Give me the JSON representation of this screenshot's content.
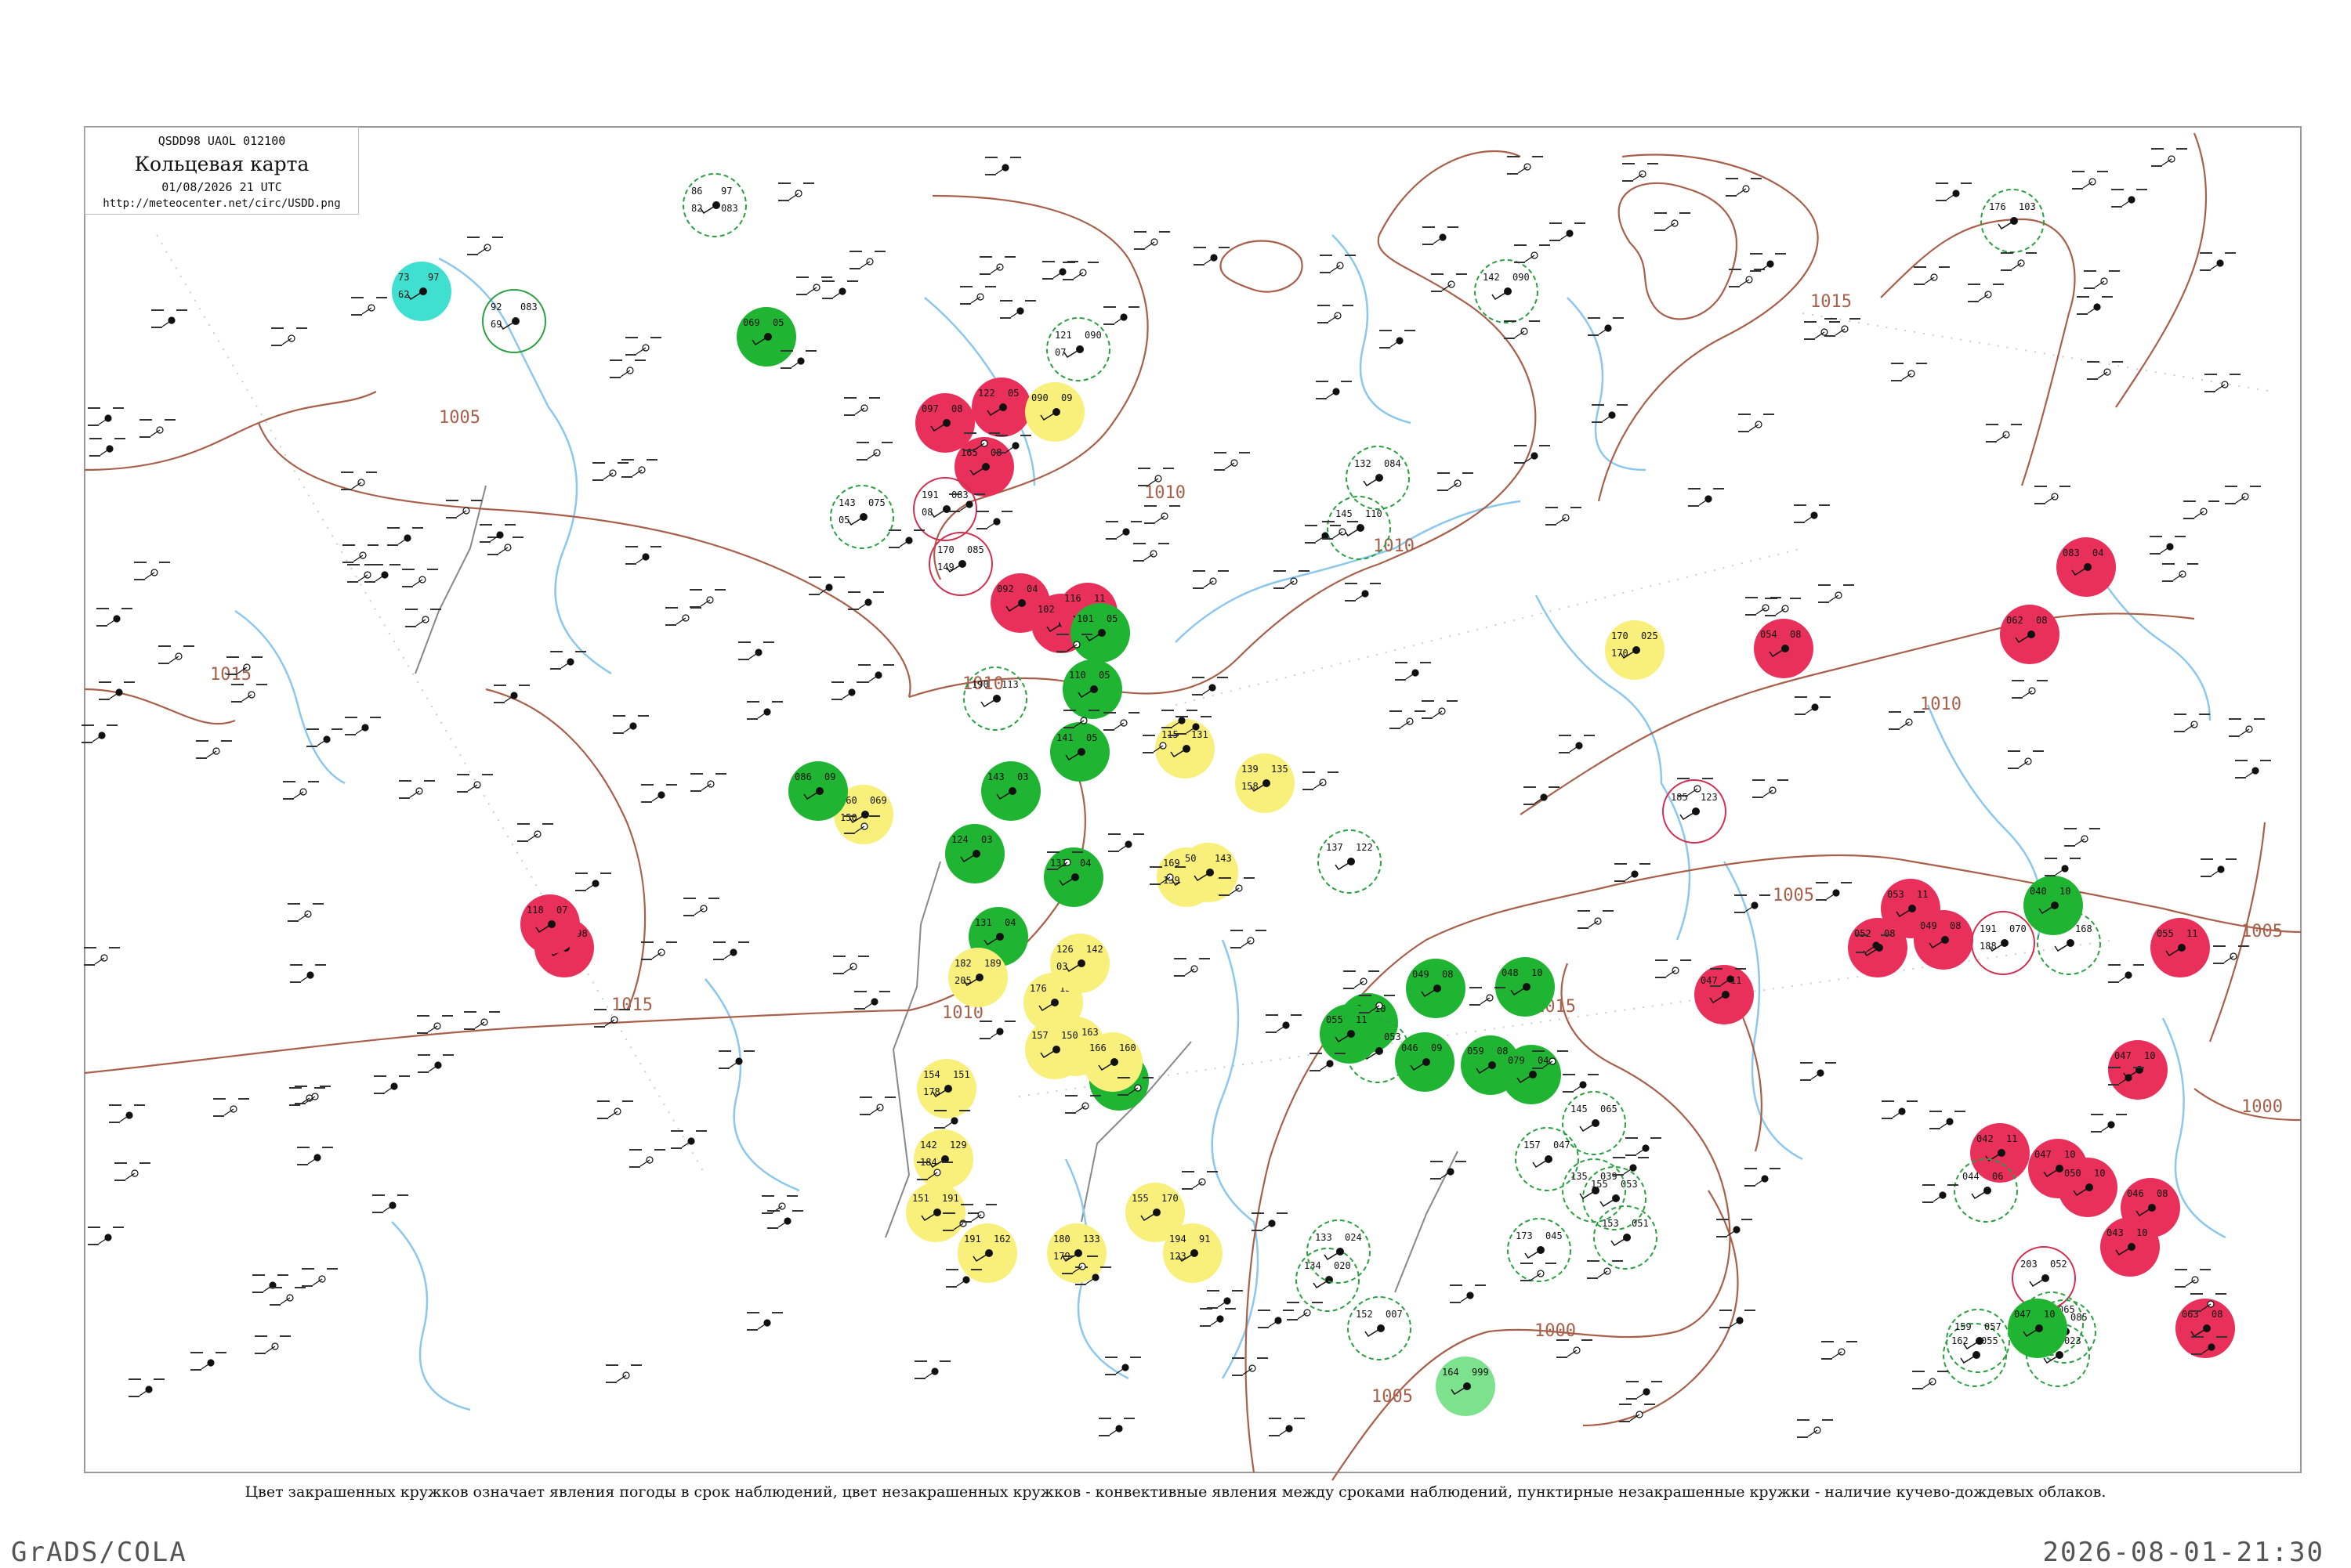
{
  "header": {
    "code": "QSDD98 UAOL 012100",
    "title": "Кольцевая карта",
    "date": "01/08/2026 21 UTC",
    "url": "http://meteocenter.net/circ/USDD.png"
  },
  "caption": "Цвет закрашенных кружков означает явления погоды в срок наблюдений, цвет незакрашенных кружков - конвективные явления между сроками наблюдений, пунктирные незакрашенные кружки - наличие кучево-дождевых облаков.",
  "footer": {
    "left": "GrADS/COLA",
    "right": "2026-08-01-21:30"
  },
  "isobar_labels": [
    "1015",
    "1010",
    "1010",
    "1010",
    "1015",
    "1010",
    "1015",
    "1010",
    "1005",
    "1005",
    "1015",
    "1000",
    "1000",
    "1005",
    "1005"
  ],
  "colors": {
    "isobar": "#a8604a",
    "river": "#8cc8ee",
    "border": "#888888",
    "filled_red": "#e8305a",
    "filled_green": "#1fb532",
    "filled_cyan": "#3fe0d0",
    "filled_yellow": "#f8f07a",
    "filled_lightgreen": "#7de28e"
  },
  "stations": [
    {
      "fill": "cyan",
      "ring": "none",
      "v": [
        "73",
        "97",
        "62"
      ]
    },
    {
      "fill": "none",
      "ring": "green",
      "v": [
        "92",
        "083",
        "69"
      ]
    },
    {
      "fill": "green",
      "ring": "none",
      "v": [
        "069",
        "05"
      ]
    },
    {
      "fill": "none",
      "ring": "green-dash",
      "v": [
        "86",
        "97",
        "82",
        "083"
      ]
    },
    {
      "fill": "red",
      "ring": "none",
      "v": [
        "097",
        "08"
      ]
    },
    {
      "fill": "red",
      "ring": "none",
      "v": [
        "122",
        "05"
      ]
    },
    {
      "fill": "red",
      "ring": "none",
      "v": [
        "165",
        "08"
      ]
    },
    {
      "fill": "yellow",
      "ring": "none",
      "v": [
        "090",
        "09"
      ]
    },
    {
      "fill": "none",
      "ring": "green-dash",
      "v": [
        "121",
        "090",
        "07"
      ]
    },
    {
      "fill": "none",
      "ring": "green-dash",
      "v": [
        "143",
        "075",
        "05"
      ]
    },
    {
      "fill": "none",
      "ring": "red",
      "v": [
        "191",
        "083",
        "08"
      ]
    },
    {
      "fill": "none",
      "ring": "red",
      "v": [
        "170",
        "085",
        "149"
      ]
    },
    {
      "fill": "red",
      "ring": "none",
      "v": [
        "092",
        "04"
      ]
    },
    {
      "fill": "red",
      "ring": "none",
      "v": [
        "102",
        "07"
      ]
    },
    {
      "fill": "red",
      "ring": "none",
      "v": [
        "116",
        "11"
      ]
    },
    {
      "fill": "none",
      "ring": "green-dash",
      "v": [
        "190",
        "113"
      ]
    },
    {
      "fill": "green",
      "ring": "none",
      "v": [
        "101",
        "05"
      ]
    },
    {
      "fill": "green",
      "ring": "none",
      "v": [
        "110",
        "05"
      ]
    },
    {
      "fill": "green",
      "ring": "none",
      "v": [
        "141",
        "05"
      ]
    },
    {
      "fill": "green",
      "ring": "none",
      "v": [
        "143",
        "03"
      ]
    },
    {
      "fill": "green",
      "ring": "none",
      "v": [
        "124",
        "03"
      ]
    },
    {
      "fill": "green",
      "ring": "none",
      "v": [
        "133",
        "04"
      ]
    },
    {
      "fill": "green",
      "ring": "none",
      "v": [
        "131",
        "04"
      ]
    },
    {
      "fill": "green",
      "ring": "none",
      "v": [
        "128",
        "06"
      ]
    },
    {
      "fill": "red",
      "ring": "none",
      "v": [
        "128",
        "198"
      ]
    },
    {
      "fill": "red",
      "ring": "none",
      "v": [
        "118",
        "07"
      ]
    },
    {
      "fill": "yellow",
      "ring": "none",
      "v": [
        "182",
        "189",
        "205"
      ]
    },
    {
      "fill": "yellow",
      "ring": "none",
      "v": [
        "176",
        "157"
      ]
    },
    {
      "fill": "yellow",
      "ring": "none",
      "v": [
        "165",
        "163",
        "169"
      ]
    },
    {
      "fill": "yellow",
      "ring": "none",
      "v": [
        "154",
        "151",
        "178"
      ]
    },
    {
      "fill": "yellow",
      "ring": "none",
      "v": [
        "142",
        "129",
        "184"
      ]
    },
    {
      "fill": "yellow",
      "ring": "none",
      "v": [
        "151",
        "191"
      ]
    },
    {
      "fill": "yellow",
      "ring": "none",
      "v": [
        "191",
        "162"
      ]
    },
    {
      "fill": "yellow",
      "ring": "none",
      "v": [
        "180",
        "133",
        "179"
      ]
    },
    {
      "fill": "yellow",
      "ring": "none",
      "v": [
        "126",
        "142",
        "03"
      ]
    },
    {
      "fill": "yellow",
      "ring": "none",
      "v": [
        "157",
        "150"
      ]
    },
    {
      "fill": "yellow",
      "ring": "none",
      "v": [
        "166",
        "160"
      ]
    },
    {
      "fill": "yellow",
      "ring": "none",
      "v": [
        "155",
        "170"
      ]
    },
    {
      "fill": "yellow",
      "ring": "none",
      "v": [
        "194",
        "91",
        "123"
      ]
    },
    {
      "fill": "yellow",
      "ring": "none",
      "v": [
        "115",
        "131"
      ]
    },
    {
      "fill": "yellow",
      "ring": "none",
      "v": [
        "139",
        "135",
        "158"
      ]
    },
    {
      "fill": "yellow",
      "ring": "none",
      "v": [
        "169",
        "108",
        "159"
      ]
    },
    {
      "fill": "yellow",
      "ring": "none",
      "v": [
        "50",
        "143"
      ]
    },
    {
      "fill": "yellow",
      "ring": "none",
      "v": [
        "160",
        "069",
        "150"
      ]
    },
    {
      "fill": "yellow",
      "ring": "none",
      "v": [
        "170",
        "025",
        "170"
      ]
    },
    {
      "fill": "none",
      "ring": "red",
      "v": [
        "185",
        "123"
      ]
    },
    {
      "fill": "green",
      "ring": "none",
      "v": [
        "083",
        "10"
      ]
    },
    {
      "fill": "green",
      "ring": "none",
      "v": [
        "086",
        "09"
      ]
    },
    {
      "fill": "none",
      "ring": "green-dash",
      "v": [
        "142",
        "090"
      ]
    },
    {
      "fill": "none",
      "ring": "green-dash",
      "v": [
        "176",
        "103"
      ]
    },
    {
      "fill": "none",
      "ring": "green-dash",
      "v": [
        "132",
        "084"
      ]
    },
    {
      "fill": "none",
      "ring": "green-dash",
      "v": [
        "145",
        "110"
      ]
    },
    {
      "fill": "none",
      "ring": "green-dash",
      "v": [
        "137",
        "122"
      ]
    },
    {
      "fill": "none",
      "ring": "green-dash",
      "v": [
        "211",
        "053"
      ]
    },
    {
      "fill": "red",
      "ring": "none",
      "v": [
        "083",
        "04"
      ]
    },
    {
      "fill": "red",
      "ring": "none",
      "v": [
        "062",
        "08"
      ]
    },
    {
      "fill": "red",
      "ring": "none",
      "v": [
        "054",
        "08"
      ]
    },
    {
      "fill": "red",
      "ring": "none",
      "v": [
        "053",
        "11"
      ]
    },
    {
      "fill": "red",
      "ring": "none",
      "v": [
        "052",
        "08"
      ]
    },
    {
      "fill": "red",
      "ring": "none",
      "v": [
        "049",
        "08"
      ]
    },
    {
      "fill": "none",
      "ring": "red",
      "v": [
        "191",
        "070",
        "188"
      ]
    },
    {
      "fill": "none",
      "ring": "green-dash",
      "v": [
        "136",
        "168"
      ]
    },
    {
      "fill": "green",
      "ring": "none",
      "v": [
        "040",
        "10"
      ]
    },
    {
      "fill": "red",
      "ring": "none",
      "v": [
        "055",
        "11"
      ]
    },
    {
      "fill": "red",
      "ring": "none",
      "v": [
        "047",
        "11"
      ]
    },
    {
      "fill": "red",
      "ring": "none",
      "v": [
        "047",
        "10"
      ]
    },
    {
      "fill": "red",
      "ring": "none",
      "v": [
        "042",
        "11"
      ]
    },
    {
      "fill": "none",
      "ring": "green-dash",
      "v": [
        "044",
        "06"
      ]
    },
    {
      "fill": "red",
      "ring": "none",
      "v": [
        "047",
        "10"
      ]
    },
    {
      "fill": "red",
      "ring": "none",
      "v": [
        "050",
        "10"
      ]
    },
    {
      "fill": "red",
      "ring": "none",
      "v": [
        "046",
        "08"
      ]
    },
    {
      "fill": "red",
      "ring": "none",
      "v": [
        "043",
        "10"
      ]
    },
    {
      "fill": "none",
      "ring": "red",
      "v": [
        "203",
        "052"
      ]
    },
    {
      "fill": "none",
      "ring": "green-dash",
      "v": [
        "149",
        "065"
      ]
    },
    {
      "fill": "none",
      "ring": "green-dash",
      "v": [
        "173",
        "085"
      ]
    },
    {
      "fill": "none",
      "ring": "green-dash",
      "v": [
        "162",
        "055"
      ]
    },
    {
      "fill": "none",
      "ring": "green-dash",
      "v": [
        "175",
        "023"
      ]
    },
    {
      "fill": "none",
      "ring": "green-dash",
      "v": [
        "159",
        "057"
      ]
    },
    {
      "fill": "red",
      "ring": "none",
      "v": [
        "063",
        "08"
      ]
    },
    {
      "fill": "green",
      "ring": "none",
      "v": [
        "047",
        "10"
      ]
    },
    {
      "fill": "green",
      "ring": "none",
      "v": [
        "049",
        "08"
      ]
    },
    {
      "fill": "green",
      "ring": "none",
      "v": [
        "055",
        "11"
      ]
    },
    {
      "fill": "green",
      "ring": "none",
      "v": [
        "046",
        "09"
      ]
    },
    {
      "fill": "green",
      "ring": "none",
      "v": [
        "059",
        "08"
      ]
    },
    {
      "fill": "green",
      "ring": "none",
      "v": [
        "048",
        "10"
      ]
    },
    {
      "fill": "green",
      "ring": "none",
      "v": [
        "079",
        "04"
      ]
    },
    {
      "fill": "none",
      "ring": "green-dash",
      "v": [
        "145",
        "065"
      ]
    },
    {
      "fill": "none",
      "ring": "green-dash",
      "v": [
        "157",
        "047"
      ]
    },
    {
      "fill": "none",
      "ring": "green-dash",
      "v": [
        "155",
        "053"
      ]
    },
    {
      "fill": "none",
      "ring": "green-dash",
      "v": [
        "153",
        "051"
      ]
    },
    {
      "fill": "none",
      "ring": "green-dash",
      "v": [
        "152",
        "007"
      ]
    },
    {
      "fill": "none",
      "ring": "green-dash",
      "v": [
        "173",
        "045"
      ]
    },
    {
      "fill": "none",
      "ring": "green-dash",
      "v": [
        "135",
        "039"
      ]
    },
    {
      "fill": "lightgreen",
      "ring": "none",
      "v": [
        "164",
        "999"
      ]
    },
    {
      "fill": "none",
      "ring": "green-dash",
      "v": [
        "134",
        "020"
      ]
    },
    {
      "fill": "none",
      "ring": "green-dash",
      "v": [
        "133",
        "024"
      ]
    }
  ]
}
